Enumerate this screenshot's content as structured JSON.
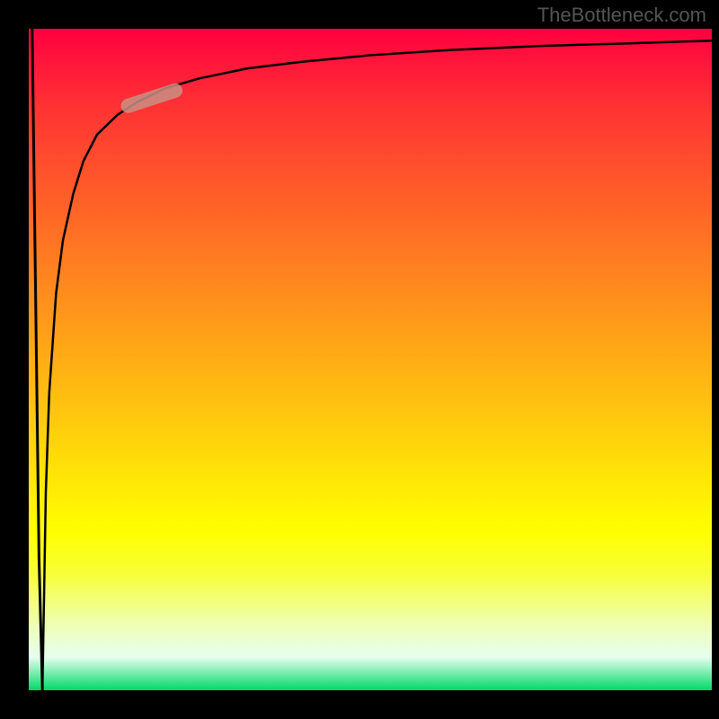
{
  "watermark": "TheBottleneck.com",
  "chart_data": {
    "type": "line",
    "title": "",
    "xlabel": "",
    "ylabel": "",
    "xlim": [
      0,
      100
    ],
    "ylim": [
      0,
      100
    ],
    "grid": false,
    "background_gradient": {
      "direction": "vertical",
      "stops": [
        {
          "pos": 0,
          "color": "#ff0040"
        },
        {
          "pos": 50,
          "color": "#ff9900"
        },
        {
          "pos": 75,
          "color": "#ffff00"
        },
        {
          "pos": 100,
          "color": "#00d966"
        }
      ]
    },
    "series": [
      {
        "name": "initial-drop",
        "color": "#000000",
        "stroke_width": 3,
        "x": [
          0.5,
          1.0,
          1.5,
          2.0
        ],
        "y": [
          100,
          60,
          20,
          0
        ]
      },
      {
        "name": "log-curve",
        "color": "#000000",
        "stroke_width": 2.5,
        "x": [
          2.0,
          2.5,
          3.0,
          4.0,
          5.0,
          6.5,
          8.0,
          10,
          13,
          16,
          20,
          25,
          32,
          40,
          50,
          62,
          75,
          88,
          100
        ],
        "y": [
          0,
          30,
          45,
          60,
          68,
          75,
          80,
          84,
          87,
          89,
          91,
          92.5,
          94,
          95,
          96,
          96.8,
          97.4,
          97.8,
          98.2
        ]
      }
    ],
    "annotations": [
      {
        "name": "highlight-segment",
        "shape": "capsule",
        "color": "#c98f84",
        "opacity": 0.85,
        "x_range": [
          14,
          22
        ],
        "y_range": [
          87,
          92
        ],
        "rotation_deg": -18
      }
    ]
  }
}
